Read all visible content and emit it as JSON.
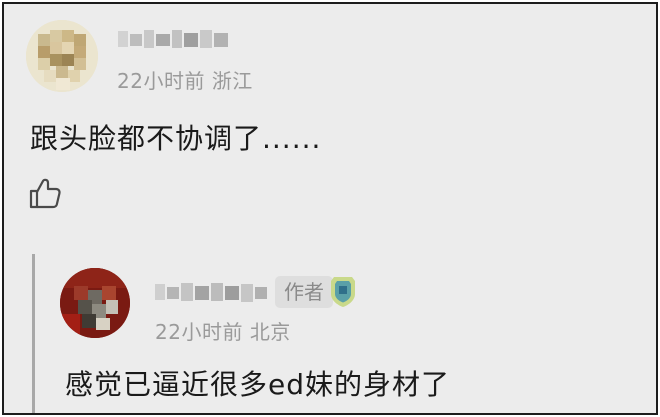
{
  "comment": {
    "time": "22小时前",
    "location": "浙江",
    "text": "跟头脸都不协调了......"
  },
  "reply": {
    "badge": "作者",
    "time": "22小时前",
    "location": "北京",
    "text": "感觉已逼近很多ed妹的身材了"
  },
  "icons": {
    "like": "thumbs-up-icon",
    "medal": "medal-icon"
  },
  "colors": {
    "background": "#ececec",
    "meta_text": "#9a9a9a",
    "badge_bg": "#dedede",
    "reply_bar": "#a8a8a8"
  }
}
